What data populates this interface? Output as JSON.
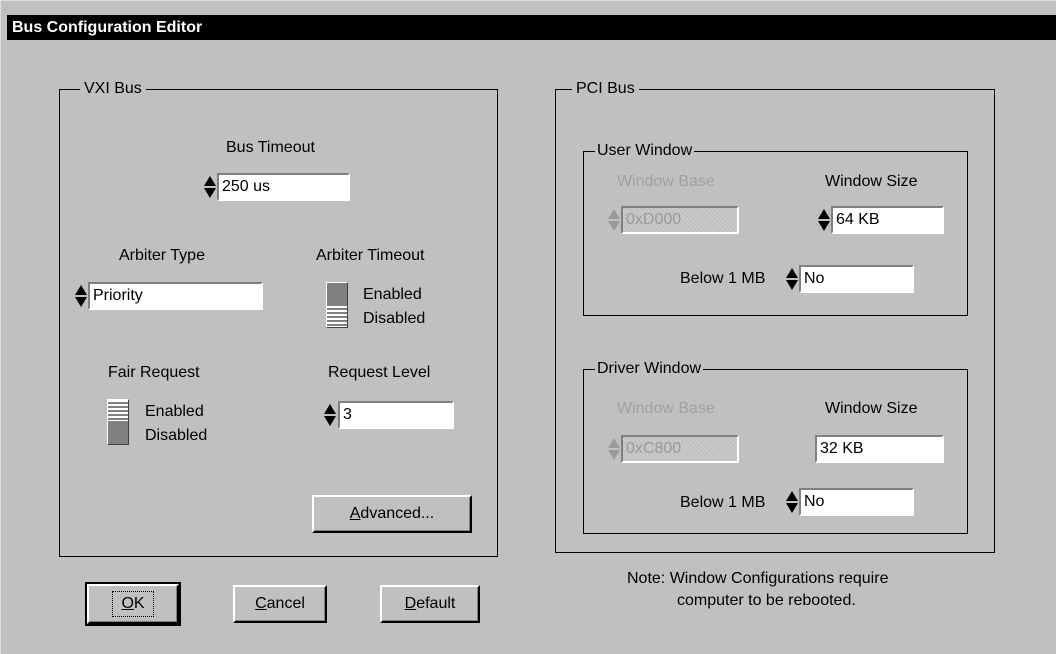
{
  "window": {
    "title": "Bus Configuration Editor"
  },
  "vxi": {
    "group_label": "VXI Bus",
    "bus_timeout": {
      "label": "Bus Timeout",
      "value": "250 us"
    },
    "arbiter_type": {
      "label": "Arbiter Type",
      "value": "Priority"
    },
    "arbiter_timeout": {
      "label": "Arbiter Timeout",
      "on_label": "Enabled",
      "off_label": "Disabled",
      "state": "Disabled"
    },
    "fair_request": {
      "label": "Fair Request",
      "on_label": "Enabled",
      "off_label": "Disabled",
      "state": "Enabled"
    },
    "request_level": {
      "label": "Request Level",
      "value": "3"
    },
    "advanced_button": {
      "mnemonic": "A",
      "rest": "dvanced..."
    }
  },
  "pci": {
    "group_label": "PCI Bus",
    "user_window": {
      "label": "User Window",
      "base_label": "Window Base",
      "base_value": "0xD000",
      "size_label": "Window Size",
      "size_value": "64 KB",
      "below_label": "Below 1 MB",
      "below_value": "No"
    },
    "driver_window": {
      "label": "Driver Window",
      "base_label": "Window Base",
      "base_value": "0xC800",
      "size_label": "Window Size",
      "size_value": "32 KB",
      "below_label": "Below 1 MB",
      "below_value": "No"
    },
    "note_line1": "Note: Window Configurations require",
    "note_line2": "computer to be rebooted."
  },
  "buttons": {
    "ok": {
      "mnemonic": "O",
      "rest": "K"
    },
    "cancel": {
      "mnemonic": "C",
      "rest": "ancel"
    },
    "default": {
      "mnemonic": "D",
      "rest": "efault"
    }
  }
}
